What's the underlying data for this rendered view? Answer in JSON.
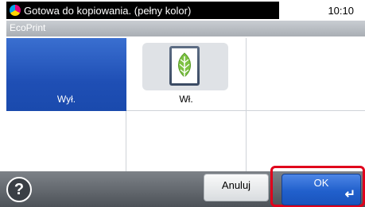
{
  "status": {
    "message": "Gotowa do kopiowania. (pełny kolor)",
    "time": "10:10",
    "icon": "color-copy-icon"
  },
  "title": "EcoPrint",
  "options": {
    "off_label": "Wył.",
    "on_label": "Wł.",
    "on_icon": "eco-leaf-icon",
    "selected": "off"
  },
  "footer": {
    "help_label": "?",
    "cancel_label": "Anuluj",
    "ok_label": "OK",
    "ok_icon": "enter-arrow-icon"
  },
  "colors": {
    "accent": "#1f4fb5",
    "highlight": "#e0001b",
    "leaf": "#7dc242"
  }
}
